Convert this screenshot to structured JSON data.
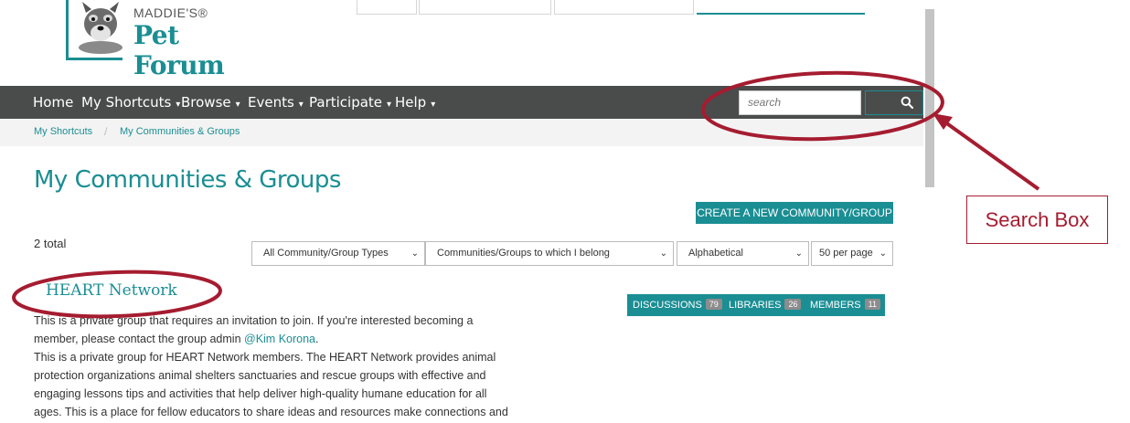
{
  "logo": {
    "small_text": "MADDIE'S®",
    "big_text": "Pet Forum"
  },
  "nav": {
    "items": [
      {
        "label": "Home",
        "caret": ""
      },
      {
        "label": "My Shortcuts",
        "caret": "▾"
      },
      {
        "label": "Browse",
        "caret": "▾"
      },
      {
        "label": "Events",
        "caret": "▾"
      },
      {
        "label": "Participate",
        "caret": "▾"
      },
      {
        "label": "Help",
        "caret": "▾"
      }
    ],
    "search_placeholder": "search",
    "search_icon": "search-icon"
  },
  "breadcrumb": {
    "items": [
      "My Shortcuts",
      "My Communities & Groups"
    ],
    "separator": "/"
  },
  "page_title": "My Communities & Groups",
  "create_button": "CREATE A NEW COMMUNITY/GROUP",
  "total": "2 total",
  "filters": {
    "type": "All Community/Group Types",
    "membership": "Communities/Groups to which I belong",
    "sort": "Alphabetical",
    "per_page": "50 per page",
    "chevron": "⌄"
  },
  "group": {
    "title": "HEART Network",
    "discussions_label": "DISCUSSIONS",
    "discussions_count": "79",
    "libraries_label": "LIBRARIES",
    "libraries_count": "26",
    "members_label": "MEMBERS",
    "members_count": "11",
    "desc_line1": "This is a private group that requires an invitation to join. If you're interested becoming a",
    "desc_line2_pre": "member, please contact the group admin ",
    "desc_line2_link": "@Kim Korona",
    "desc_line2_post": ".",
    "desc_line3": "This is a private group for HEART Network members. The HEART Network provides animal",
    "desc_line4": "protection organizations animal shelters sanctuaries and rescue groups with effective and",
    "desc_line5": "engaging lessons tips and activities that help deliver high-quality humane education for all",
    "desc_line6": "ages. This is a place for fellow educators to share ideas and resources make connections and"
  },
  "annotation": {
    "label": "Search Box"
  },
  "colors": {
    "teal": "#1a8e93",
    "nav_bg": "#4a4b4b",
    "annotation": "#a51c30"
  }
}
